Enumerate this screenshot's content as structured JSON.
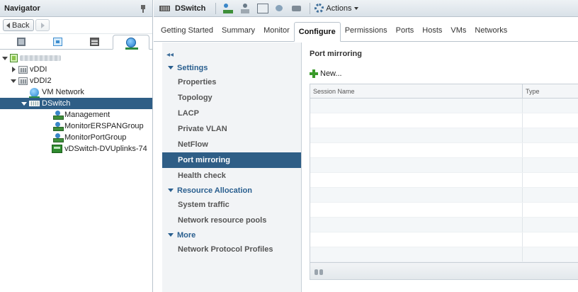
{
  "navigator": {
    "title": "Navigator",
    "back_label": "Back",
    "tree": [
      {
        "label": "vDDI",
        "type": "folder"
      },
      {
        "label": "vDDI2",
        "type": "folder"
      },
      {
        "label": "VM Network",
        "type": "network"
      },
      {
        "label": "DSwitch",
        "type": "switch",
        "selected": true
      },
      {
        "label": "Management",
        "type": "portgroup"
      },
      {
        "label": "MonitorERSPANGroup",
        "type": "portgroup"
      },
      {
        "label": "MonitorPortGroup",
        "type": "portgroup"
      },
      {
        "label": "vDSwitch-DVUplinks-74",
        "type": "uplink"
      }
    ]
  },
  "toolbar": {
    "object_name": "DSwitch",
    "actions_label": "Actions"
  },
  "tabs": [
    {
      "label": "Getting Started"
    },
    {
      "label": "Summary"
    },
    {
      "label": "Monitor"
    },
    {
      "label": "Configure",
      "active": true
    },
    {
      "label": "Permissions"
    },
    {
      "label": "Ports"
    },
    {
      "label": "Hosts"
    },
    {
      "label": "VMs"
    },
    {
      "label": "Networks"
    }
  ],
  "left_nav": {
    "collapse_glyph": "◂◂",
    "settings_header": "Settings",
    "settings_items": [
      "Properties",
      "Topology",
      "LACP",
      "Private VLAN",
      "NetFlow",
      "Port mirroring",
      "Health check"
    ],
    "selected_item": "Port mirroring",
    "resource_header": "Resource Allocation",
    "resource_items": [
      "System traffic",
      "Network resource pools"
    ],
    "more_header": "More",
    "more_items": [
      "Network Protocol Profiles"
    ]
  },
  "content": {
    "title": "Port mirroring",
    "new_label": "New...",
    "columns": [
      "Session Name",
      "Type"
    ],
    "rows": []
  },
  "colors": {
    "selection": "#2f5e86",
    "header_gradient_top": "#eef2f5",
    "section_header": "#2a5f8f"
  }
}
